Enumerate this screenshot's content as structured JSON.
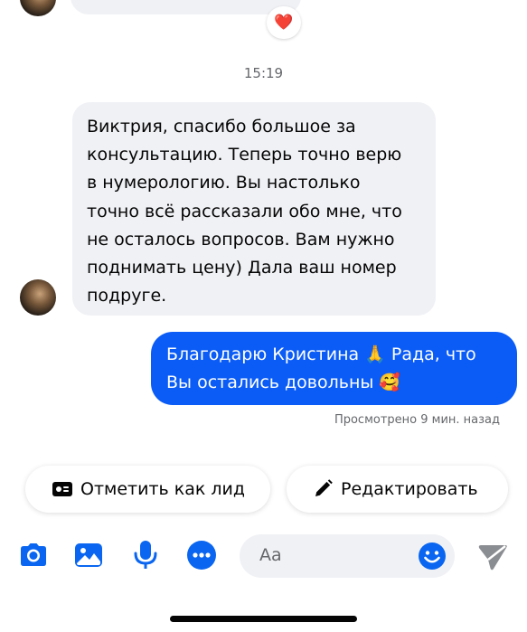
{
  "conversation": {
    "previous_reaction": "❤️",
    "timestamp": "15:19",
    "incoming_message": "Виктрия,  спасибо большое за\nконсультацию. Теперь точно верю\nв нумерологию. Вы настолько\nточно всё рассказали обо мне, что\nне осталось вопросов. Вам нужно\nподнимать цену) Дала ваш номер\nподруге.",
    "outgoing_message_part1": "Благодарю Кристина 🙏 Рада, что",
    "outgoing_message_part2": "Вы остались довольны 🥰",
    "seen_status": "Просмотрено 9 мин. назад"
  },
  "quick_actions": {
    "mark_lead_label": "Отметить как лид",
    "edit_label": "Редактировать"
  },
  "composer": {
    "placeholder": "Aa",
    "icons": [
      "camera-icon",
      "gallery-icon",
      "microphone-icon",
      "more-icon",
      "emoji-icon",
      "send-icon"
    ]
  },
  "colors": {
    "accent": "#0b5cf6",
    "icon_blue": "#0a66f0",
    "incoming_bubble": "#f0f1f5",
    "muted_text": "#65676b"
  }
}
